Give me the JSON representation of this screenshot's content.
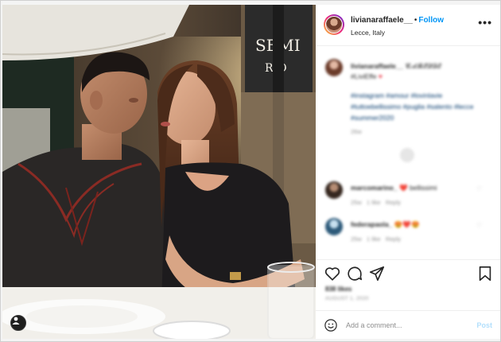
{
  "post": {
    "username": "livianaraffaele__",
    "separator": "•",
    "follow_label": "Follow",
    "location": "Lecce, Italy",
    "more_icon": "more-horizontal-icon",
    "more_label": "•••"
  },
  "caption": {
    "username": "livianaraffaele__",
    "text": "𝓒𝓐𝓡𝓔𝓓𝓓𝓔",
    "emoji": "♥",
    "line2": "#LiviEffe",
    "hashtags": "#instagram #amour #lovinlavie #tuttoebellissimo #puglia #salento #lecce #summer2020",
    "time": "26w"
  },
  "comments": [
    {
      "username": "marcomarino_",
      "emoji": "❤️",
      "text": "bellissimi",
      "time": "25w",
      "likes": "1 like",
      "reply": "Reply"
    },
    {
      "username": "federapaola_",
      "emoji": "😍❤️😍",
      "text": "",
      "time": "25w",
      "likes": "1 like",
      "reply": "Reply"
    }
  ],
  "actions": {
    "like_icon": "heart-icon",
    "comment_icon": "comment-icon",
    "share_icon": "send-icon",
    "save_icon": "bookmark-icon"
  },
  "likes_text": "838 likes",
  "date_text": "AUGUST 1, 2020",
  "add_comment": {
    "placeholder": "Add a comment...",
    "post_label": "Post"
  },
  "colors": {
    "follow": "#0095f6",
    "post_disabled": "#b2dffc",
    "heart_red": "#ed4956",
    "muted": "#8e8e8e"
  }
}
